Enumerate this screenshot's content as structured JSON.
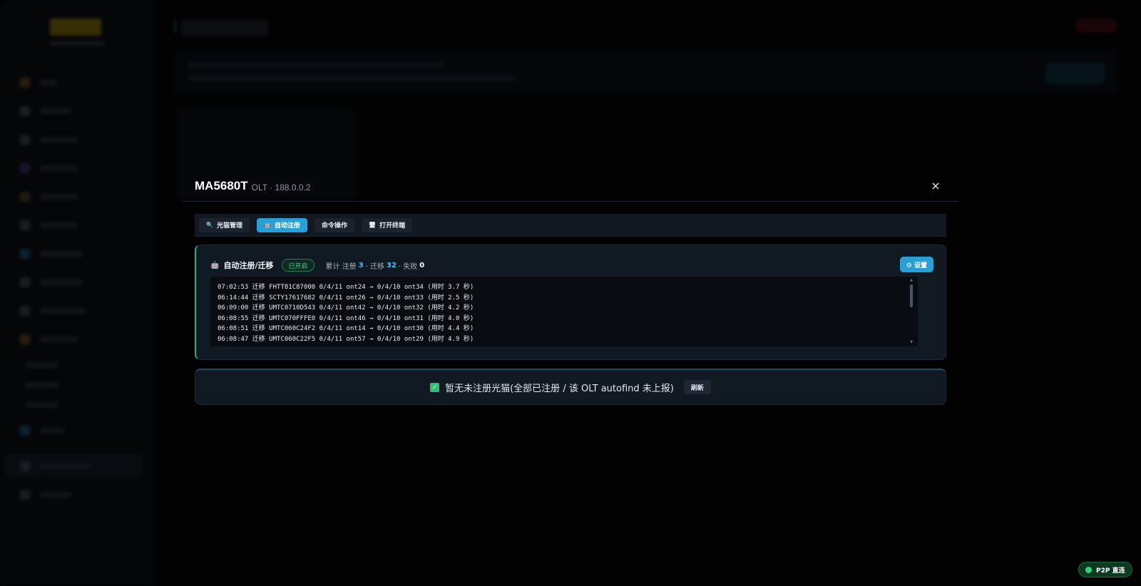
{
  "modal": {
    "title": "MA5680T",
    "subtitle": "OLT · 188.0.0.2",
    "close_label": "×"
  },
  "tabs": [
    {
      "icon": "🔍",
      "label": "光猫管理",
      "active": false
    },
    {
      "icon": "🤖",
      "label": "自动注册",
      "active": true
    },
    {
      "icon": "",
      "label": "命令操作",
      "active": false
    },
    {
      "icon": "🖥",
      "label": "打开终端",
      "active": false
    }
  ],
  "auto_panel": {
    "icon": "🤖",
    "title": "自动注册/迁移",
    "status_badge": "已开启",
    "stats": {
      "prefix": "累计 注册",
      "registered": "3",
      "sep1": "· 迁移",
      "migrated": "32",
      "sep2": "· 失败",
      "failed": "0"
    },
    "settings_label": "⚙ 设置",
    "log_lines": [
      "07:02:53 迁移 FHTT81C87000 0/4/11 ont24 → 0/4/10 ont34 (用时 3.7 秒)",
      "06:14:44 迁移 SCTY17617682 0/4/11 ont26 → 0/4/10 ont33 (用时 2.5 秒)",
      "06:09:00 迁移 UMTC0710D543 0/4/11 ont42 → 0/4/10 ont32 (用时 4.2 秒)",
      "06:08:55 迁移 UMTC070FFFE0 0/4/11 ont46 → 0/4/10 ont31 (用时 4.0 秒)",
      "06:08:51 迁移 UMTC060C24F2 0/4/11 ont14 → 0/4/10 ont30 (用时 4.4 秒)",
      "06:08:47 迁移 UMTC060C22F5 0/4/11 ont57 → 0/4/10 ont29 (用时 4.9 秒)"
    ]
  },
  "unregistered_panel": {
    "check_icon": "✓",
    "message": "暂无未注册光猫(全部已注册 / 该 OLT autofind 未上报)",
    "refresh_label": "刷新"
  },
  "p2p_badge": {
    "label": "P2P 直连"
  },
  "colors": {
    "accent": "#2a9fd6",
    "success": "#27b27a",
    "stat_highlight": "#4cc3ff"
  }
}
